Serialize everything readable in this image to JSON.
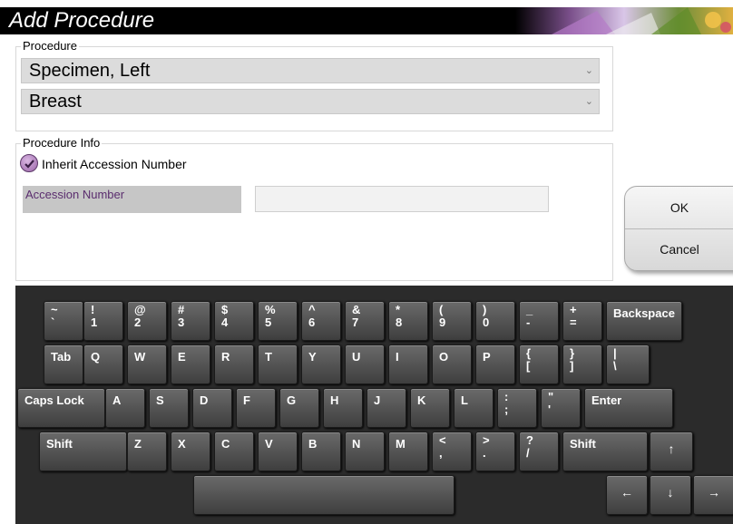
{
  "window": {
    "title": "Add Procedure"
  },
  "procedure": {
    "group_label": "Procedure",
    "procedure_value": "Specimen, Left",
    "body_part_value": "Breast"
  },
  "procedure_info": {
    "group_label": "Procedure Info",
    "inherit_label": "Inherit Accession Number",
    "inherit_checked": true,
    "accession_label": "Accession Number",
    "accession_value": ""
  },
  "buttons": {
    "ok": "OK",
    "cancel": "Cancel"
  },
  "colors": {
    "accent_purple": "#9a64a8",
    "keyboard_bg": "#2b2b2b",
    "titlebar_bg": "#000000"
  },
  "keyboard": {
    "row1": [
      {
        "top": "~",
        "bot": "`"
      },
      {
        "top": "!",
        "bot": "1"
      },
      {
        "top": "@",
        "bot": "2"
      },
      {
        "top": "#",
        "bot": "3"
      },
      {
        "top": "$",
        "bot": "4"
      },
      {
        "top": "%",
        "bot": "5"
      },
      {
        "top": "^",
        "bot": "6"
      },
      {
        "top": "&",
        "bot": "7"
      },
      {
        "top": "*",
        "bot": "8"
      },
      {
        "top": "(",
        "bot": "9"
      },
      {
        "top": ")",
        "bot": "0"
      },
      {
        "top": "_",
        "bot": "-"
      },
      {
        "top": "+",
        "bot": "="
      },
      {
        "label": "Backspace"
      }
    ],
    "row2": [
      {
        "label": "Tab"
      },
      {
        "label": "Q"
      },
      {
        "label": "W"
      },
      {
        "label": "E"
      },
      {
        "label": "R"
      },
      {
        "label": "T"
      },
      {
        "label": "Y"
      },
      {
        "label": "U"
      },
      {
        "label": "I"
      },
      {
        "label": "O"
      },
      {
        "label": "P"
      },
      {
        "top": "{",
        "bot": "["
      },
      {
        "top": "}",
        "bot": "]"
      },
      {
        "top": "|",
        "bot": "\\"
      }
    ],
    "row3": [
      {
        "label": "Caps Lock"
      },
      {
        "label": "A"
      },
      {
        "label": "S"
      },
      {
        "label": "D"
      },
      {
        "label": "F"
      },
      {
        "label": "G"
      },
      {
        "label": "H"
      },
      {
        "label": "J"
      },
      {
        "label": "K"
      },
      {
        "label": "L"
      },
      {
        "top": ":",
        "bot": ";"
      },
      {
        "top": "\"",
        "bot": "'"
      },
      {
        "label": "Enter"
      }
    ],
    "row4": [
      {
        "label": "Shift"
      },
      {
        "label": "Z"
      },
      {
        "label": "X"
      },
      {
        "label": "C"
      },
      {
        "label": "V"
      },
      {
        "label": "B"
      },
      {
        "label": "N"
      },
      {
        "label": "M"
      },
      {
        "top": "<",
        "bot": ","
      },
      {
        "top": ">",
        "bot": "."
      },
      {
        "top": "?",
        "bot": "/"
      },
      {
        "label": "Shift"
      },
      {
        "arrow": "↑"
      }
    ],
    "row5": [
      {
        "label": ""
      },
      {
        "arrow": "←"
      },
      {
        "arrow": "↓"
      },
      {
        "arrow": "→"
      }
    ]
  }
}
